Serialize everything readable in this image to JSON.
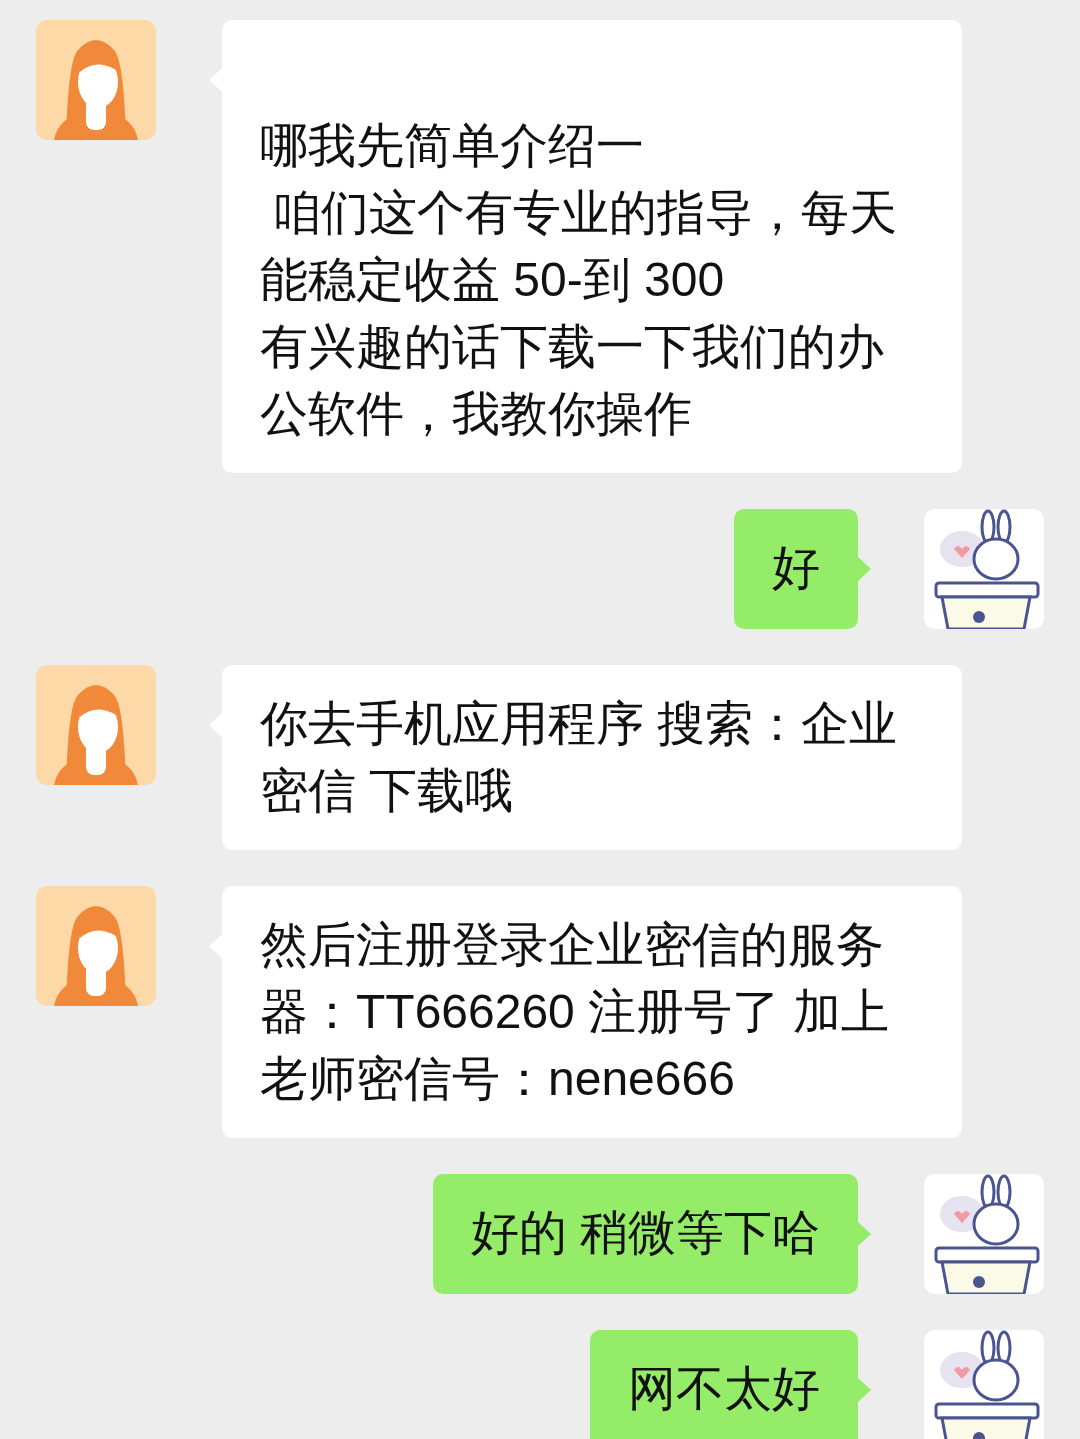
{
  "messages": [
    {
      "kind": "incoming",
      "paragraphs": [
        "\n哪我先简单介绍一",
        " 咱们这个有专业的指导，每天能稳定收益 50-到 300",
        "有兴趣的话下载一下我们的办公软件，我教你操作"
      ]
    },
    {
      "kind": "outgoing",
      "paragraphs": [
        "好"
      ]
    },
    {
      "kind": "incoming",
      "paragraphs": [
        "你去手机应用程序 搜索：企业密信 下载哦"
      ]
    },
    {
      "kind": "incoming",
      "paragraphs": [
        "然后注册登录企业密信的服务器：TT666260 注册号了 加上老师密信号：nene666"
      ]
    },
    {
      "kind": "outgoing",
      "paragraphs": [
        "好的 稍微等下哈"
      ]
    },
    {
      "kind": "outgoing",
      "paragraphs": [
        "网不太好"
      ]
    }
  ]
}
